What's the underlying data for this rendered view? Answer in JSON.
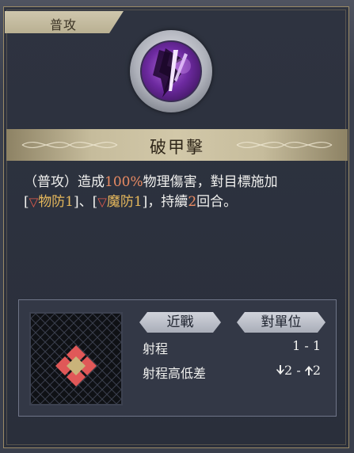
{
  "header": {
    "tab_label": "普攻"
  },
  "skill": {
    "icon": "purple-slash-skill-icon",
    "name": "破甲擊",
    "desc": {
      "p1": "（普攻）造成",
      "pct": "100%",
      "p2": "物理傷害，對目標施加",
      "bo1": "[",
      "tri1": "▽",
      "buff1": "物防1",
      "bc1": "]",
      "sep": "、",
      "bo2": "[",
      "tri2": "▽",
      "buff2": "魔防1",
      "bc2": "]",
      "p3": "，持續",
      "turns": "2",
      "p4": "回合。"
    }
  },
  "info": {
    "tag_melee": "近戰",
    "tag_target": "對單位",
    "range_label": "射程",
    "range_value": "1 - 1",
    "height_label": "射程高低差",
    "height_low": "2",
    "height_sep": " - ",
    "height_high": "2"
  },
  "colors": {
    "damage_highlight": "#e98b63",
    "debuff_highlight": "#e6b85c",
    "tile_red": "#e05858",
    "tile_center": "#c9b37a"
  }
}
